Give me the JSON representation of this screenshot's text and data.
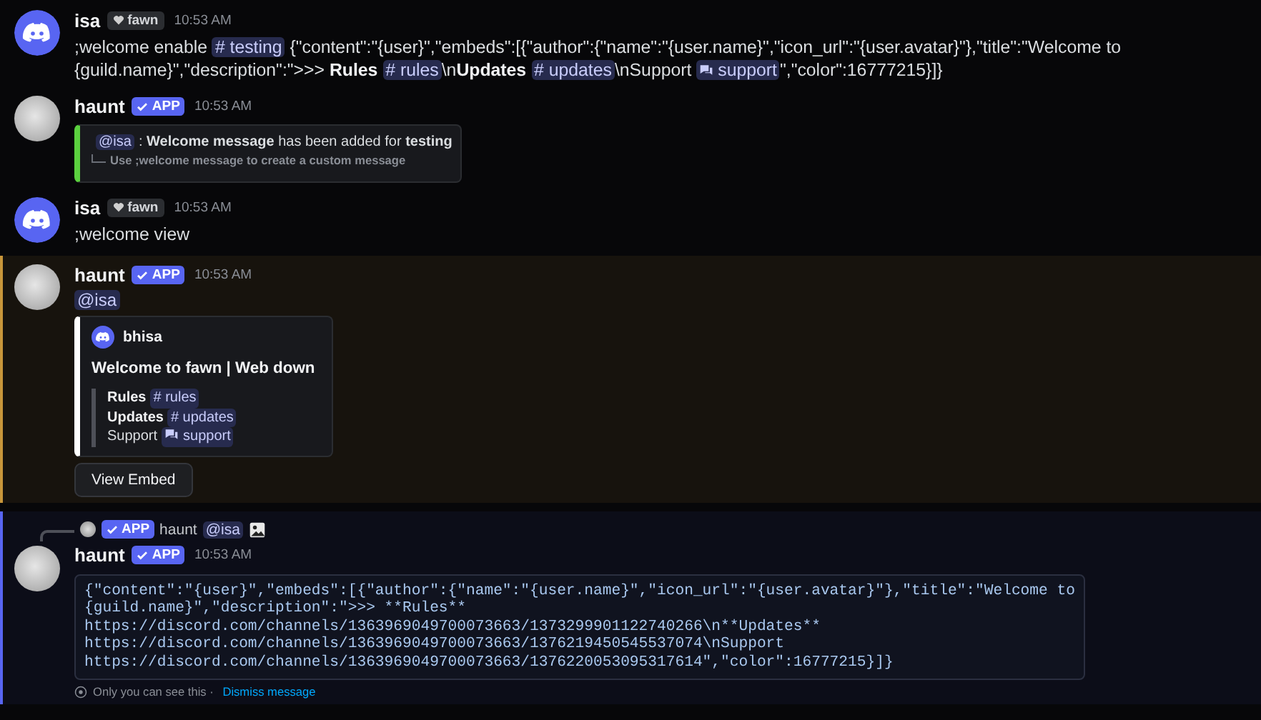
{
  "messages": [
    {
      "kind": "text",
      "mentioned": false,
      "ephemeral": false,
      "avatar": {
        "kind": "logo"
      },
      "author": "isa",
      "badge": {
        "kind": "tag",
        "label": "fawn"
      },
      "time": "10:53 AM",
      "segments": [
        {
          "kind": "text",
          "text": ";welcome enable "
        },
        {
          "kind": "channel",
          "text": "# testing"
        },
        {
          "kind": "text",
          "text": " {\"content\":\"{user}\",\"embeds\":[{\"author\":{\"name\":\"{user.name}\",\"icon_url\":\"{user.avatar}\"},\"title\":\"Welcome to {guild.name}\",\"description\":\">>> "
        },
        {
          "kind": "bold",
          "text": "Rules "
        },
        {
          "kind": "channel",
          "text": "# rules"
        },
        {
          "kind": "text",
          "text": "\\n"
        },
        {
          "kind": "bold",
          "text": "Updates "
        },
        {
          "kind": "channel",
          "text": "# updates"
        },
        {
          "kind": "text",
          "text": "\\nSupport "
        },
        {
          "kind": "forum",
          "text": "support"
        },
        {
          "kind": "text",
          "text": "\",\"color\":16777215}]}"
        }
      ]
    },
    {
      "kind": "status",
      "mentioned": false,
      "ephemeral": false,
      "avatar": {
        "kind": "photo"
      },
      "author": "haunt",
      "badge": {
        "kind": "app",
        "label": "APP"
      },
      "time": "10:53 AM",
      "embed": {
        "color": "#5bd13f",
        "mention": "@isa",
        "text": ": **Welcome message** has been added for **testing**",
        "hint": "Use ;welcome message to create a custom message"
      }
    },
    {
      "kind": "text",
      "mentioned": false,
      "ephemeral": false,
      "avatar": {
        "kind": "logo"
      },
      "author": "isa",
      "badge": {
        "kind": "tag",
        "label": "fawn"
      },
      "time": "10:53 AM",
      "segments": [
        {
          "kind": "text",
          "text": ";welcome view"
        }
      ]
    },
    {
      "kind": "welcome",
      "mentioned": true,
      "ephemeral": false,
      "avatar": {
        "kind": "photo"
      },
      "author": "haunt",
      "badge": {
        "kind": "app",
        "label": "APP"
      },
      "time": "10:53 AM",
      "mention": "@isa",
      "embed": {
        "color": "#ffffff",
        "author": "bhisa",
        "title": "Welcome to fawn | Web down",
        "fields": [
          {
            "label": "Rules",
            "bold": true,
            "kind": "channel",
            "channel": "# rules"
          },
          {
            "label": "Updates",
            "bold": true,
            "kind": "channel",
            "channel": "# updates"
          },
          {
            "label": "Support",
            "bold": false,
            "kind": "forum",
            "channel": "support"
          }
        ]
      },
      "button": "View Embed"
    },
    {
      "kind": "code",
      "mentioned": false,
      "ephemeral": true,
      "avatar": {
        "kind": "photo"
      },
      "author": "haunt",
      "badge": {
        "kind": "app",
        "label": "APP"
      },
      "time": "10:53 AM",
      "reply": {
        "badge": "APP",
        "author": "haunt",
        "mention": "@isa"
      },
      "code": [
        "{\"content\":\"{user}\",\"embeds\":[{\"author\":{\"name\":\"{user.name}\",\"icon_url\":\"{user.avatar}\"},\"title\":\"Welcome to",
        "{guild.name}\",\"description\":\">>> **Rules**",
        "https://discord.com/channels/1363969049700073663/1373299901122740266\\n**Updates**",
        "https://discord.com/channels/1363969049700073663/1376219450545537074\\nSupport",
        "https://discord.com/channels/1363969049700073663/1376220053095317614\",\"color\":16777215}]}"
      ],
      "notice": "Only you can see this · ",
      "dismiss": "Dismiss message"
    }
  ]
}
